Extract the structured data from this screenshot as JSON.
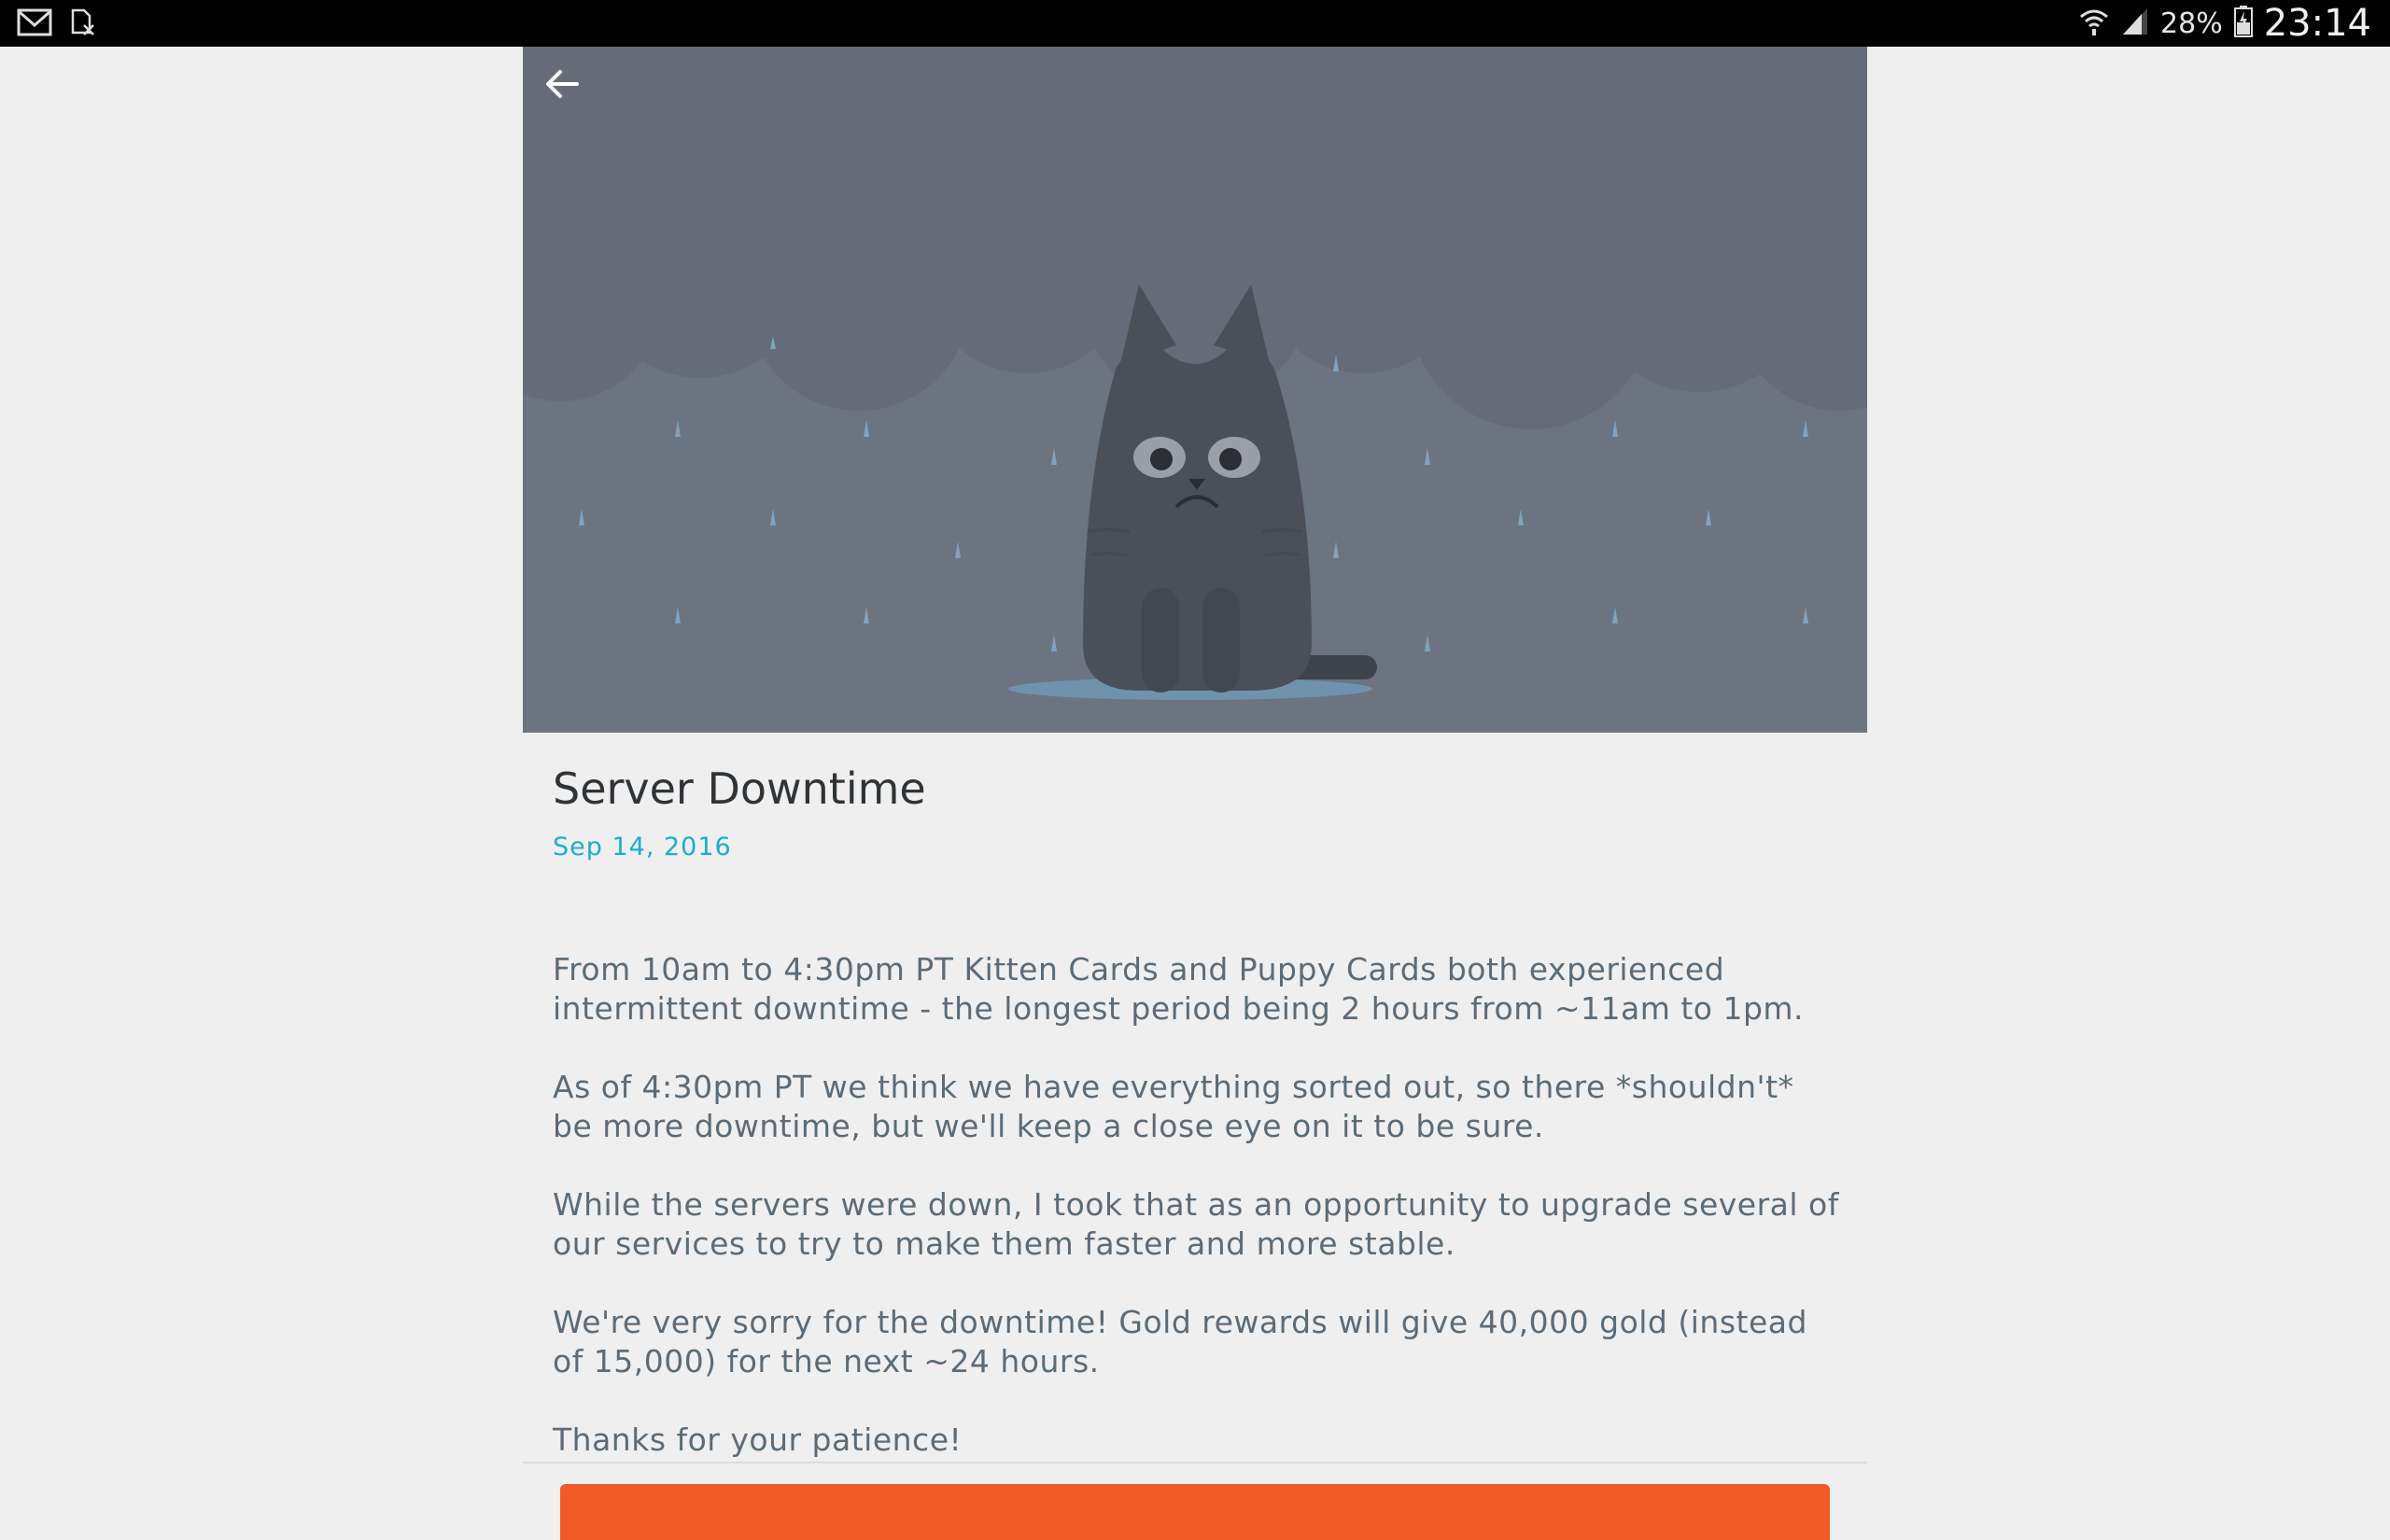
{
  "status_bar": {
    "icons_left": [
      "gmail-icon",
      "sim-error-icon"
    ],
    "icons_right": [
      "wifi-icon",
      "signal-icon",
      "battery-icon"
    ],
    "battery_percent": "28%",
    "time": "23:14"
  },
  "hero": {
    "back_icon": "arrow-left-icon",
    "illustration": "sad-cat-in-rain",
    "background_color": "#6c7480"
  },
  "post": {
    "title": "Server Downtime",
    "date": "Sep 14, 2016",
    "paragraphs": [
      "From 10am to 4:30pm PT Kitten Cards and Puppy Cards both experienced intermittent downtime - the longest period being 2 hours from ~11am to 1pm.",
      "As of 4:30pm PT we think we have everything sorted out, so there *shouldn't* be more downtime, but we'll keep a close eye on it to be sure.",
      "While the servers were down, I took that as an opportunity to upgrade several of our services to try to make them faster and more stable.",
      "We're very sorry for the downtime! Gold rewards will give 40,000 gold (instead of 15,000) for the next ~24 hours.",
      "Thanks for your patience!"
    ]
  },
  "colors": {
    "accent": "#1aaed0",
    "action": "#f05a28",
    "text": "#5b6c78"
  }
}
